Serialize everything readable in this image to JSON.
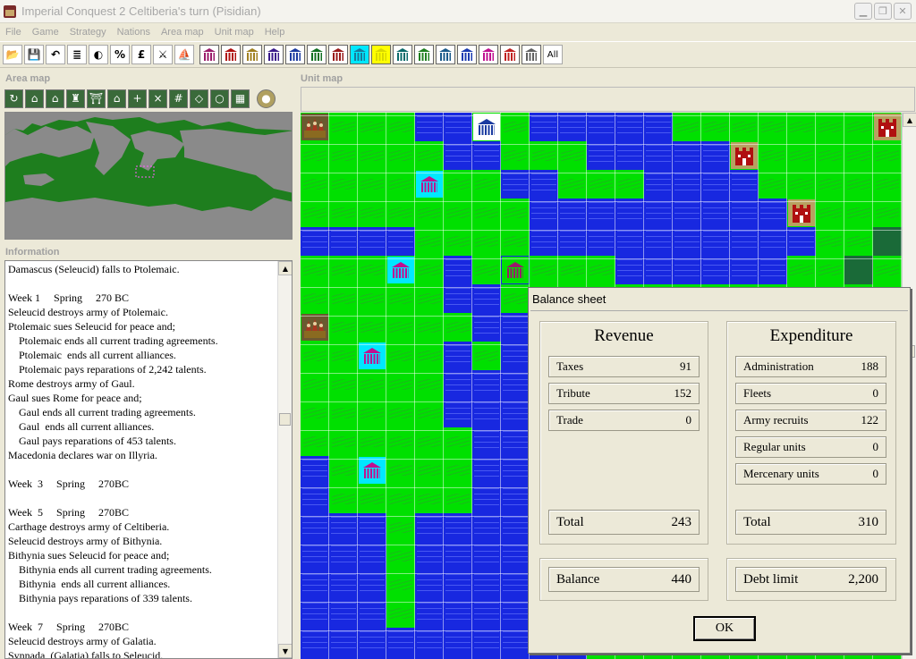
{
  "window": {
    "title": "Imperial Conquest 2    Celtiberia's turn   (Pisidian)"
  },
  "menu": [
    "File",
    "Game",
    "Strategy",
    "Nations",
    "Area map",
    "Unit map",
    "Help"
  ],
  "toolbar": {
    "tools": [
      {
        "name": "open-icon",
        "glyph": "📂"
      },
      {
        "name": "save-icon",
        "glyph": "💾"
      },
      {
        "name": "undo-icon",
        "glyph": "↶"
      },
      {
        "name": "list-icon",
        "glyph": "≣"
      },
      {
        "name": "contrast-icon",
        "glyph": "◐"
      },
      {
        "name": "percent-icon",
        "glyph": "%"
      },
      {
        "name": "pound-icon",
        "glyph": "£"
      },
      {
        "name": "swords-icon",
        "glyph": "⚔"
      },
      {
        "name": "ship-icon",
        "glyph": "⛵"
      }
    ],
    "nation_colors": [
      "#9a1a6a",
      "#b01010",
      "#a08020",
      "#3a1a8a",
      "#1a3aa0",
      "#107020",
      "#9a1a1a",
      "#1a7a9a",
      "#d8d800",
      "#0a6a6a",
      "#208020",
      "#1a5a8a",
      "#1a3ab0",
      "#c01090",
      "#c02020",
      "#606060"
    ],
    "nation_bg": [
      "#ffffff",
      "#ffffff",
      "#ffffff",
      "#ffffff",
      "#ffffff",
      "#ffffff",
      "#ffffff",
      "#00e8ff",
      "#ffff00",
      "#ffffff",
      "#ffffff",
      "#ffffff",
      "#ffffff",
      "#ffffff",
      "#ffffff",
      "#ffffff"
    ],
    "all_label": "All"
  },
  "area_map": {
    "header": "Area map",
    "tools": [
      "↻",
      "⌂",
      "⌂",
      "♜",
      "⛩",
      "⌂",
      "+",
      "×",
      "#",
      "◇",
      "○",
      "▦",
      "●"
    ]
  },
  "information": {
    "header": "Information",
    "lines": [
      "Damascus (Seleucid) falls to Ptolemaic.",
      "",
      "Week 1     Spring     270 BC",
      "Seleucid destroys army of Ptolemaic.",
      "Ptolemaic sues Seleucid for peace and;",
      "    Ptolemaic ends all current trading agreements.",
      "    Ptolemaic  ends all current alliances.",
      "    Ptolemaic pays reparations of 2,242 talents.",
      "Rome destroys army of Gaul.",
      "Gaul sues Rome for peace and;",
      "    Gaul ends all current trading agreements.",
      "    Gaul  ends all current alliances.",
      "    Gaul pays reparations of 453 talents.",
      "Macedonia declares war on Illyria.",
      "",
      "Week  3     Spring     270BC",
      "",
      "Week  5     Spring     270BC",
      "Carthage destroys army of Celtiberia.",
      "Seleucid destroys army of Bithynia.",
      "Bithynia sues Seleucid for peace and;",
      "    Bithynia ends all current trading agreements.",
      "    Bithynia  ends all current alliances.",
      "    Bithynia pays reparations of 339 talents.",
      "",
      "Week  7     Spring     270BC",
      "Seleucid destroys army of Galatia.",
      "Synnada  (Galatia) falls to Seleucid."
    ]
  },
  "unit_map": {
    "header": "Unit map",
    "rows": [
      "LLLLSSWLSSSSSLLLLLLLL",
      "LLLLLSSLLLSSSSSLLLLLL",
      "LLLLLLLSSLLLSSSSLLLLL",
      "LLLLLLLLSSSSSSSSSLLLL",
      "SSSSLLLLSSSSSSSSSSLLD",
      "LLLLLSLSLLLSSSSSSLLDL",
      "LLLLLSSLLLLLLLLLLLLLL",
      "LLLLLLSSLLLLLLLLLLLLL",
      "LLLLLSLSSLLLLLLLLLLLL",
      "LLLLLSSSSLLLLLLLLLLLL",
      "LLLLLSSSSLLLLLLLLLLLL",
      "LLLLLLSSSLLLLLLLLLLLL",
      "SLLLLLSSSLLLLLLLLLLLL",
      "SLLLLLSSSLLLLLLLLLLLL",
      "SSSLSSSSSLLLLLLLLLLLL",
      "SSSLSSSSSLLLLLLLLLLLL",
      "SSSLSSSSSLLLLLLLLLLLL",
      "SSSLSSSSSLLLLLLLLLLLL",
      "SSSSSSSSSSLLLLLLLLLLL",
      "SSSSSSSSSSLLLLLLLLLLL"
    ],
    "units": [
      {
        "row": 0,
        "col": 0,
        "kind": "army",
        "color": "#6a4a10",
        "bg": "#6a5a30"
      },
      {
        "row": 0,
        "col": 6,
        "kind": "city",
        "color": "#1a3aa0",
        "bg": "#ffffff"
      },
      {
        "row": 0,
        "col": 20,
        "kind": "fort",
        "color": "#b01010",
        "bg": "#b8a060"
      },
      {
        "row": 1,
        "col": 15,
        "kind": "fort",
        "color": "#b01010",
        "bg": "#b8a060"
      },
      {
        "row": 2,
        "col": 4,
        "kind": "city",
        "color": "#c01090",
        "bg": "#00e8ff"
      },
      {
        "row": 3,
        "col": 17,
        "kind": "fort",
        "color": "#b01010",
        "bg": "#b8a060"
      },
      {
        "row": 5,
        "col": 3,
        "kind": "city",
        "color": "#c01090",
        "bg": "#00e8ff"
      },
      {
        "row": 5,
        "col": 7,
        "kind": "city",
        "color": "#9a1a6a",
        "bg": "#00e000"
      },
      {
        "row": 7,
        "col": 0,
        "kind": "army",
        "color": "#6a4a10",
        "bg": "#6a5a30"
      },
      {
        "row": 8,
        "col": 2,
        "kind": "city",
        "color": "#c01090",
        "bg": "#00e8ff"
      },
      {
        "row": 12,
        "col": 2,
        "kind": "city",
        "color": "#c01090",
        "bg": "#00e8ff"
      }
    ]
  },
  "balance_sheet": {
    "title": "Balance sheet",
    "revenue": {
      "header": "Revenue",
      "items": [
        {
          "label": "Taxes",
          "value": "91"
        },
        {
          "label": "Tribute",
          "value": "152"
        },
        {
          "label": "Trade",
          "value": "0"
        }
      ],
      "total_label": "Total",
      "total_value": "243"
    },
    "expenditure": {
      "header": "Expenditure",
      "items": [
        {
          "label": "Administration",
          "value": "188"
        },
        {
          "label": "Fleets",
          "value": "0"
        },
        {
          "label": "Army recruits",
          "value": "122"
        },
        {
          "label": "Regular units",
          "value": "0"
        },
        {
          "label": "Mercenary units",
          "value": "0"
        }
      ],
      "total_label": "Total",
      "total_value": "310"
    },
    "balance_label": "Balance",
    "balance_value": "440",
    "debt_limit_label": "Debt limit",
    "debt_limit_value": "2,200",
    "ok_label": "OK"
  }
}
